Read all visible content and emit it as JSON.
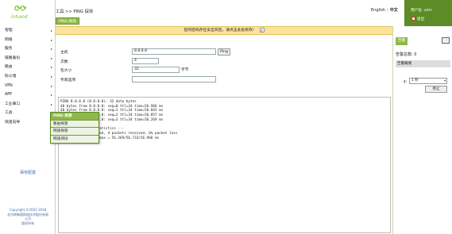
{
  "brand": {
    "logo_text": "inhand"
  },
  "sidebar": {
    "items": [
      {
        "label": "管理",
        "arrow": "▸"
      },
      {
        "label": "网络",
        "arrow": "▸"
      },
      {
        "label": "服务",
        "arrow": "▸"
      },
      {
        "label": "链路备份",
        "arrow": "▸"
      },
      {
        "label": "路由",
        "arrow": "▸"
      },
      {
        "label": "防火墙",
        "arrow": "▸"
      },
      {
        "label": "VPN",
        "arrow": "▸"
      },
      {
        "label": "APP",
        "arrow": "▸"
      },
      {
        "label": "工业串口",
        "arrow": "▸"
      },
      {
        "label": "工具",
        "arrow": "▸"
      },
      {
        "label": "快速向导",
        "arrow": "▸"
      }
    ],
    "save_label": "保存配置",
    "copyright": [
      "Copyright ©2001-2018",
      "北京映翰通网络技术股份有限",
      "公司",
      "版权所有"
    ]
  },
  "header": {
    "breadcrumb": "工具 >> PING 探测",
    "subtab": "PING 探测",
    "lang_en": "English",
    "lang_sep": "|",
    "lang_cn": "中文",
    "user_label": "用户名: adm",
    "logout_label": "退出"
  },
  "warning": {
    "text": "您的密码存在安全风险，请点击此处修改！",
    "close": "×"
  },
  "form": {
    "host_label": "主机",
    "host_value": "8.8.8.8",
    "ping_button": "Ping",
    "count_label": "次数",
    "count_value": "4",
    "size_label": "包大小",
    "size_value": "32",
    "size_unit": "字节",
    "expert_label": "专家选项",
    "expert_value": ""
  },
  "output_text": "PING 8.8.8.8 (8.8.8.8): 32 data bytes\n40 bytes from 8.8.8.8: seq=0 ttl=34 time=56.966 ms\n40 bytes from 8.8.8.8: seq=1 ttl=34 time=56.843 ms\n40 bytes from 8.8.8.8: seq=2 ttl=34 time=56.857 ms\n40 bytes from 8.8.8.8: seq=3 ttl=34 time=56.269 ms\n\n--- 8.8.8.8 ping statistics ---\n4 packets transmitted, 4 packets received, 0% packet loss\nround-trip min/avg/max = 56.269/56.733/56.966 ms",
  "submenu": {
    "items": [
      "PING 探测",
      "路由探测",
      "网速探测",
      "网速测试"
    ]
  },
  "right_panel": {
    "tab": "告警",
    "alarm_total": "告警总数: 0",
    "alarm_summary": "告警概要",
    "refresh_value": "1 秒",
    "stop_button": "停止"
  },
  "colors": {
    "accent_green": "#8fb84a",
    "dark_green": "#5d8c26",
    "warning_bg": "#fbe29d"
  }
}
